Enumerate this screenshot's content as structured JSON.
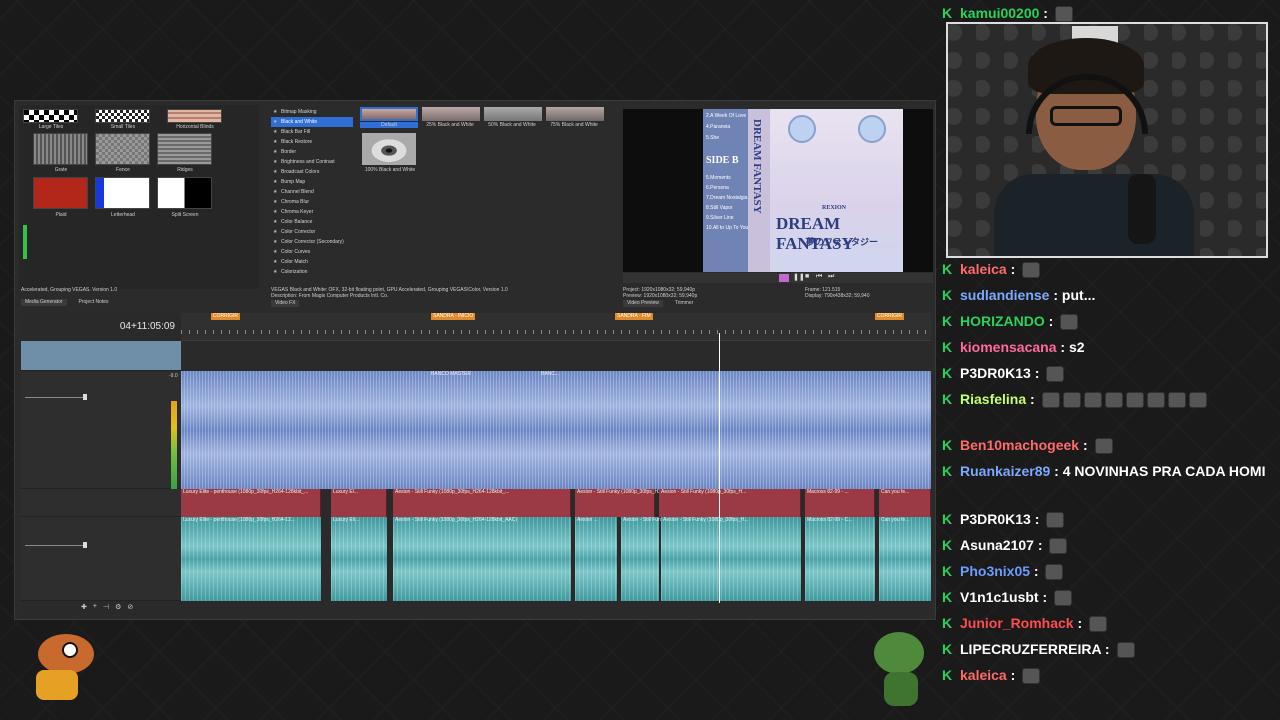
{
  "vegas": {
    "transitions": [
      "Large Tiles",
      "Small Tiles",
      "Horizontal Blinds",
      "Grate",
      "Fence",
      "Ridges",
      "Plaid",
      "Letterhead",
      "Split Screen"
    ],
    "fx_list": [
      "Bitmap Masking",
      "Black and White",
      "Black Bar Fill",
      "Black Restore",
      "Border",
      "Brightness and Contrast",
      "Broadcast Colors",
      "Bump Map",
      "Channel Blend",
      "Chroma Blur",
      "Chroma Keyer",
      "Color Balance",
      "Color Corrector",
      "Color Corrector (Secondary)",
      "Color Curves",
      "Color Match",
      "Colorization"
    ],
    "fx_selected": "Black and White",
    "presets": [
      "Default",
      "25% Black and White",
      "50% Black and White",
      "75% Black and White",
      "100% Black and White"
    ],
    "status_left": "Accelerated, Grouping VEGAS. Version 1.0",
    "status_mid_1": "VEGAS Black and White: OFX, 32-bit floating point, GPU Accelerated, Grouping VEGAS\\Color, Version 1.0",
    "status_mid_2": "Description: From Magix Computer Products Intl. Co.",
    "tabs_left": [
      "Media Generator",
      "Project Notes"
    ],
    "tab_fx": "Video FX",
    "preview": {
      "project": "Project:   1920x1080x32; 59,940p",
      "preview": "Preview:   1920x1080x32; 59,940p",
      "frame": "Frame:      121.515",
      "display": "Display:    790x438x32; 59,940",
      "tab_preview": "Video Preview",
      "tab_trimmer": "Trimmer"
    },
    "album": {
      "side_b": "SIDE B",
      "tracklist": [
        "5.Moments",
        "6.Persona",
        "7.Dream Nostalgia",
        "8.Still Vapor",
        "9.Silver Line",
        "10.All to Up To You"
      ],
      "tracklist_a": [
        "2.A Week Of Love",
        "4.Paranoia",
        "5.She"
      ],
      "artist": "REXION",
      "title": "DREAM FANTASY",
      "jp_title": "夢のファンタジー",
      "spine": "DREAM FANTASY"
    },
    "timecode": "04+11:05:09",
    "markers": [
      "CORRIGIR",
      "SANDRA - INICIO",
      "SANDRA - FIM",
      "CORRIGIR"
    ],
    "audio_clips": [
      "BANCO MASTER",
      "BANC..."
    ],
    "video_clips": [
      "Luxury Elite - penthouse (1080p_30fps_H264-128kbit_...",
      "Luxury El...",
      "Aesion - Still Funky (1080p_30fps_H264-128kbit_...",
      "Aesion - Still Funky (1080p_30fps_H264-1...",
      "Aesion - Still Funky (1080p_30fps_H...",
      "Macross 82-99 - ...",
      "Can you fe..."
    ],
    "audio_clips2": [
      "Luxury Elite - penthouse (1080p_30fps_H264-12...",
      "Luxury Eli...",
      "Aesion - Still Funky (1080p_30fps_H264-128kbit_AAC)",
      "Aesion ...",
      "Aesion - Still Funky (1080p_30fps_H264-128kbit_...",
      "Aesion - Still Funky (1080p_30fps_H...",
      "Macross 82-99 - C...",
      "Can you fe..."
    ],
    "meter_value": "-9.0"
  },
  "chat": {
    "messages": [
      {
        "user": "kamui00200",
        "color": "#2bd15c",
        "msg": "",
        "emotes": 1
      },
      {
        "user": "kaleica",
        "color": "#ff6b6b",
        "msg": "",
        "emotes": 1
      },
      {
        "user": "sudlandiense",
        "color": "#7ea8ff",
        "msg": "put...",
        "emotes": 0
      },
      {
        "user": "HORIZANDO",
        "color": "#2bd15c",
        "msg": "",
        "emotes": 1
      },
      {
        "user": "kiomensacana",
        "color": "#ff6b9d",
        "msg": "s2",
        "emotes": 0
      },
      {
        "user": "P3DR0K13",
        "color": "#ffffff",
        "msg": "",
        "emotes": 1
      },
      {
        "user": "Riasfelina",
        "color": "#c3ff6b",
        "msg": "",
        "emotes": 8
      },
      {
        "user": "Ben10machogeek",
        "color": "#ff6b6b",
        "msg": "",
        "emotes": 1
      },
      {
        "user": "Ruankaizer89",
        "color": "#7ea8ff",
        "msg": "4 NOVINHAS PRA CADA HOMI",
        "emotes": 0
      },
      {
        "user": "P3DR0K13",
        "color": "#ffffff",
        "msg": "",
        "emotes": 1
      },
      {
        "user": "Asuna2107",
        "color": "#ffffff",
        "msg": "",
        "emotes": 1
      },
      {
        "user": "Pho3nix05",
        "color": "#6b9dff",
        "msg": "",
        "emotes": 1
      },
      {
        "user": "V1n1c1usbt",
        "color": "#ffffff",
        "msg": "",
        "emotes": 1
      },
      {
        "user": "Junior_Romhack",
        "color": "#ff4d4d",
        "msg": "",
        "emotes": 1
      },
      {
        "user": "LIPECRUZFERREIRA",
        "color": "#ffffff",
        "msg": "",
        "emotes": 1
      },
      {
        "user": "kaleica",
        "color": "#ff6b6b",
        "msg": "",
        "emotes": 1
      }
    ]
  }
}
